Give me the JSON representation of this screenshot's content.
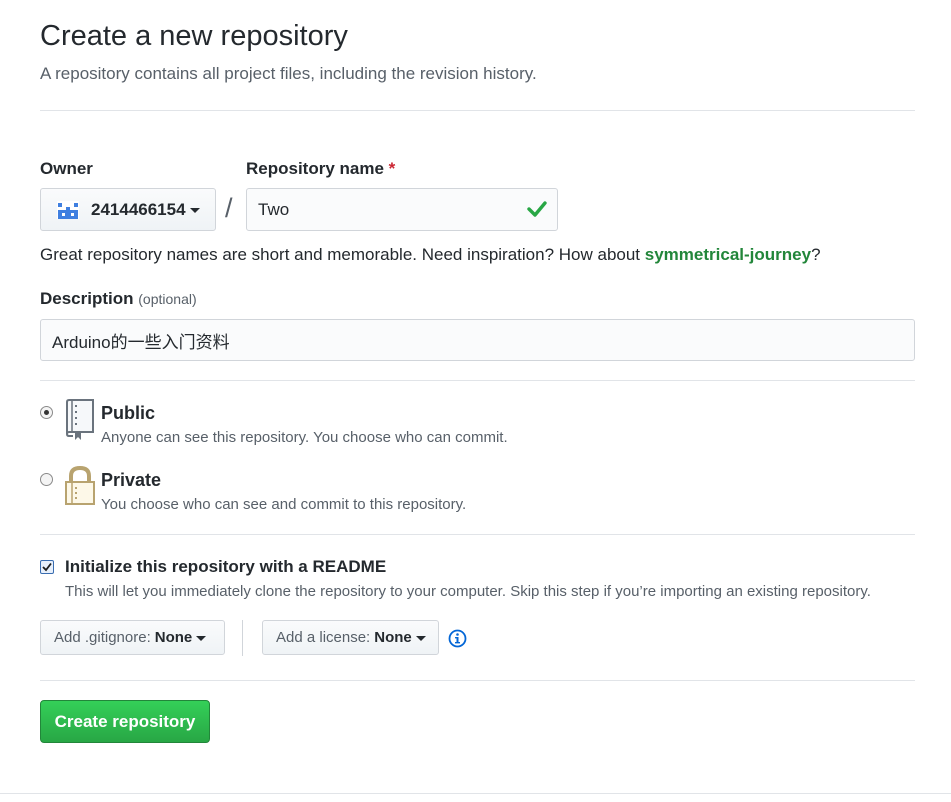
{
  "header": {
    "title": "Create a new repository",
    "subtitle": "A repository contains all project files, including the revision history."
  },
  "owner": {
    "label": "Owner",
    "value": "2414466154",
    "avatar_icon": "identicon-avatar"
  },
  "separator": "/",
  "repo_name": {
    "label": "Repository name",
    "required_mark": "*",
    "value": "Two",
    "valid_icon": "check-icon"
  },
  "name_hint": {
    "prefix": "Great repository names are short and memorable. Need inspiration? How about ",
    "suggestion": "symmetrical-journey",
    "suffix": "?"
  },
  "description": {
    "label": "Description",
    "optional": "(optional)",
    "value": "Arduino的一些入门资料"
  },
  "visibility": {
    "public": {
      "title": "Public",
      "note": "Anyone can see this repository. You choose who can commit.",
      "selected": true,
      "icon": "repo-book-icon"
    },
    "private": {
      "title": "Private",
      "note": "You choose who can see and commit to this repository.",
      "selected": false,
      "icon": "lock-icon"
    }
  },
  "readme": {
    "checked": true,
    "label": "Initialize this repository with a README",
    "note": "This will let you immediately clone the repository to your computer. Skip this step if you’re importing an existing repository."
  },
  "gitignore": {
    "label": "Add .gitignore:",
    "value": "None"
  },
  "license": {
    "label": "Add a license:",
    "value": "None",
    "info_icon": "info-icon"
  },
  "submit": {
    "label": "Create repository"
  },
  "colors": {
    "accent_green": "#28a745",
    "suggestion_green": "#22863a",
    "info_blue": "#0366d6",
    "required_red": "#cb2431"
  }
}
